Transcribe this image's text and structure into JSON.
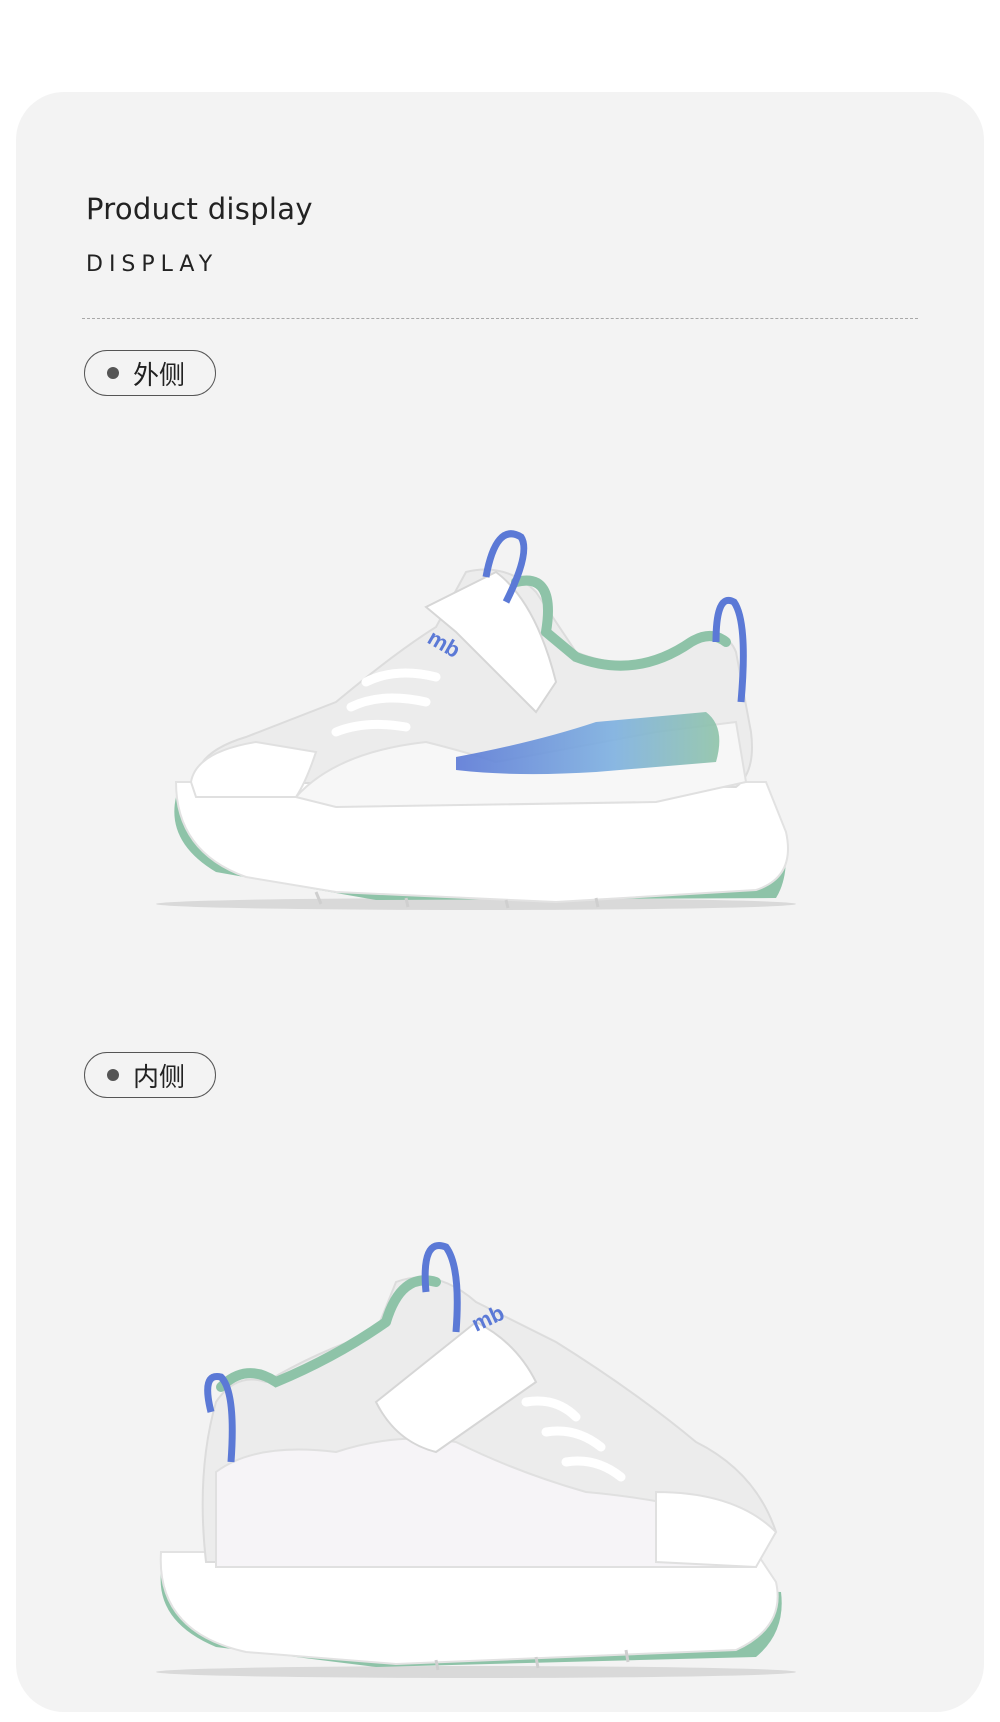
{
  "section": {
    "title": "Product display",
    "subtitle": "DISPLAY"
  },
  "views": [
    {
      "label": "外侧",
      "image": "shoe-outer-side"
    },
    {
      "label": "内侧",
      "image": "shoe-inner-side"
    }
  ],
  "colors": {
    "card_background": "#f3f3f3",
    "shoe_white": "#ffffff",
    "accent_blue": "#5b79d6",
    "accent_mint": "#8ec3a8"
  }
}
